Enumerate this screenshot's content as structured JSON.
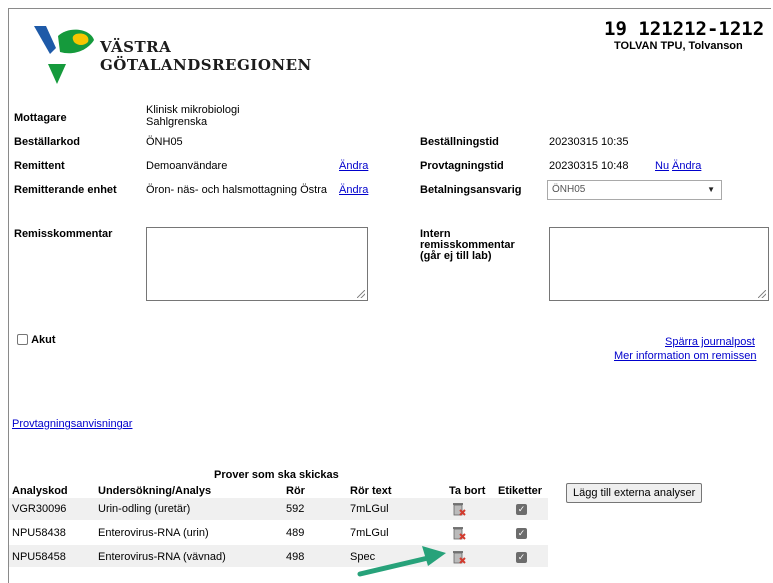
{
  "header": {
    "logo_line1": "VÄSTRA",
    "logo_line2": "GÖTALANDSREGIONEN",
    "personnummer": "19 121212-1212",
    "patient_name": "TOLVAN TPU, Tolvanson"
  },
  "form": {
    "mottagare_label": "Mottagare",
    "mottagare_value_1": "Klinisk mikrobiologi",
    "mottagare_value_2": "Sahlgrenska",
    "bestallarkod_label": "Beställarkod",
    "bestallarkod_value": "ÖNH05",
    "bestallningstid_label": "Beställningstid",
    "bestallningstid_value": "20230315 10:35",
    "remittent_label": "Remittent",
    "remittent_value": "Demoanvändare",
    "remittent_link": "Ändra",
    "provtagningstid_label": "Provtagningstid",
    "provtagningstid_value": "20230315 10:48",
    "nu_link": "Nu",
    "provtagningstid_link": "Ändra",
    "enhet_label": "Remitterande enhet",
    "enhet_value": "Öron- näs- och halsmottagning Östra",
    "enhet_link": "Ändra",
    "betalning_label": "Betalningsansvarig",
    "betalning_value": "ÖNH05",
    "remisskommentar_label": "Remisskommentar",
    "intern_label_1": "Intern",
    "intern_label_2": "remisskommentar",
    "intern_label_3": "(går ej till lab)",
    "akut_label": "Akut",
    "sparra_link": "Spärra journalpost",
    "mer_info_link": "Mer information om remissen",
    "provtagning_link": "Provtagningsanvisningar"
  },
  "table": {
    "caption": "Prover som ska skickas",
    "headers": {
      "analyskod": "Analyskod",
      "undersokning": "Undersökning/Analys",
      "ror": "Rör",
      "rortext": "Rör text",
      "tabort": "Ta bort",
      "etiketter": "Etiketter"
    },
    "rows": [
      {
        "analyskod": "VGR30096",
        "undersokning": "Urin-odling (uretär)",
        "ror": "592",
        "rortext": "7mLGul",
        "etikett": true
      },
      {
        "analyskod": "NPU58438",
        "undersokning": "Enterovirus-RNA (urin)",
        "ror": "489",
        "rortext": "7mLGul",
        "etikett": true
      },
      {
        "analyskod": "NPU58458",
        "undersokning": "Enterovirus-RNA (vävnad)",
        "ror": "498",
        "rortext": "Spec",
        "etikett": true
      }
    ],
    "add_button": "Lägg till externa analyser"
  },
  "colors": {
    "logo_blue": "#1e5aa8",
    "logo_yellow": "#f7c600",
    "logo_green": "#159a3c",
    "link_blue": "#0000cc",
    "arrow_green": "#27a27a",
    "trash_red": "#d23b2e"
  }
}
